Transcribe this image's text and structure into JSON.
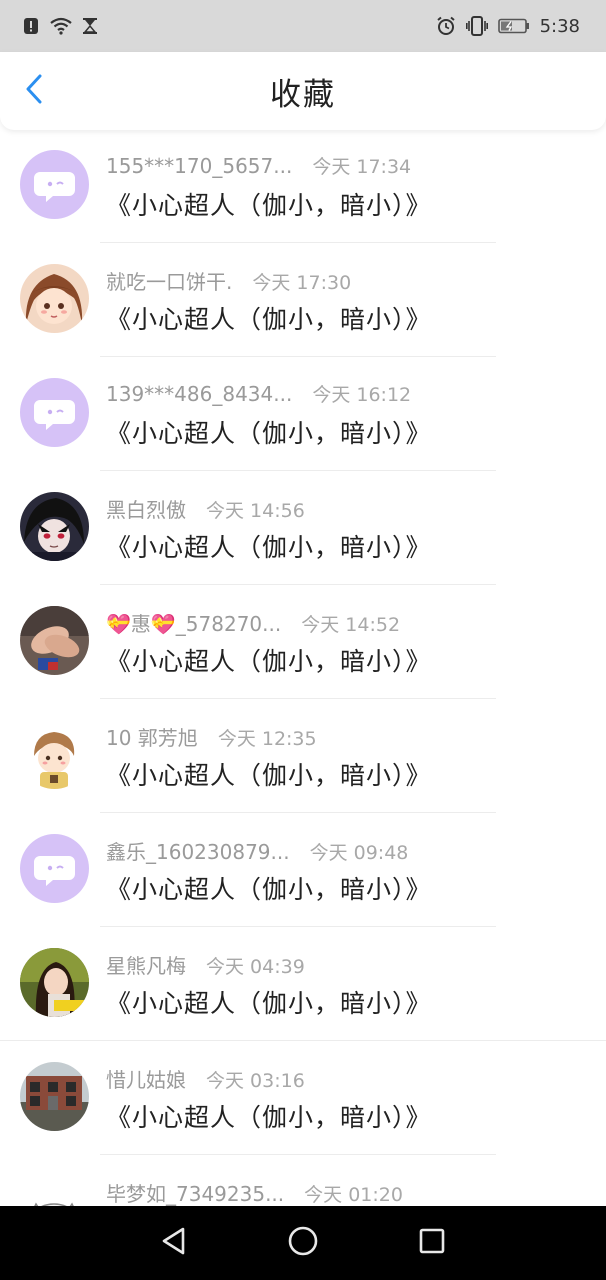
{
  "status_bar": {
    "time": "5:38",
    "icons_left": [
      "alert-icon",
      "wifi-icon",
      "hourglass-icon"
    ],
    "icons_right": [
      "alarm-icon",
      "vibrate-icon",
      "battery-icon"
    ]
  },
  "header": {
    "title": "收藏",
    "back_icon": "chevron-left-icon"
  },
  "colors": {
    "accent": "#2b8ff0",
    "default_avatar_bg": "#d6c2f7",
    "name_text": "#9a9a9a",
    "time_text": "#a8a8a8"
  },
  "items": [
    {
      "name": "155***170_5657...",
      "time": "今天 17:34",
      "content": "《小心超人（伽小，暗小）》",
      "avatar": "default-bubble"
    },
    {
      "name": "就吃一口饼干.",
      "time": "今天 17:30",
      "content": "《小心超人（伽小，暗小）》",
      "avatar": "anime-girl"
    },
    {
      "name": "139***486_8434...",
      "time": "今天 16:12",
      "content": "《小心超人（伽小，暗小）》",
      "avatar": "default-bubble"
    },
    {
      "name": "黑白烈傲",
      "time": "今天 14:56",
      "content": "《小心超人（伽小，暗小）》",
      "avatar": "dark-anime-boy"
    },
    {
      "name": "💝惠💝_578270...",
      "time": "今天 14:52",
      "content": "《小心超人（伽小，暗小）》",
      "avatar": "hands-photo"
    },
    {
      "name": "10 郭芳旭",
      "time": "今天 12:35",
      "content": "《小心超人（伽小，暗小）》",
      "avatar": "cartoon-boy"
    },
    {
      "name": "鑫乐_160230879...",
      "time": "今天 09:48",
      "content": "《小心超人（伽小，暗小）》",
      "avatar": "default-bubble"
    },
    {
      "name": "星熊凡梅",
      "time": "今天 04:39",
      "content": "《小心超人（伽小，暗小）》",
      "avatar": "girl-photo"
    },
    {
      "name": "惜儿姑娘",
      "time": "今天 03:16",
      "content": "《小心超人（伽小，暗小）》",
      "avatar": "building-photo"
    },
    {
      "name": "毕梦如_7349235...",
      "time": "今天 01:20",
      "content": "",
      "avatar": "white-cartoon"
    }
  ],
  "navbar": {
    "buttons": [
      "back-triangle-icon",
      "home-circle-icon",
      "recents-square-icon"
    ]
  }
}
